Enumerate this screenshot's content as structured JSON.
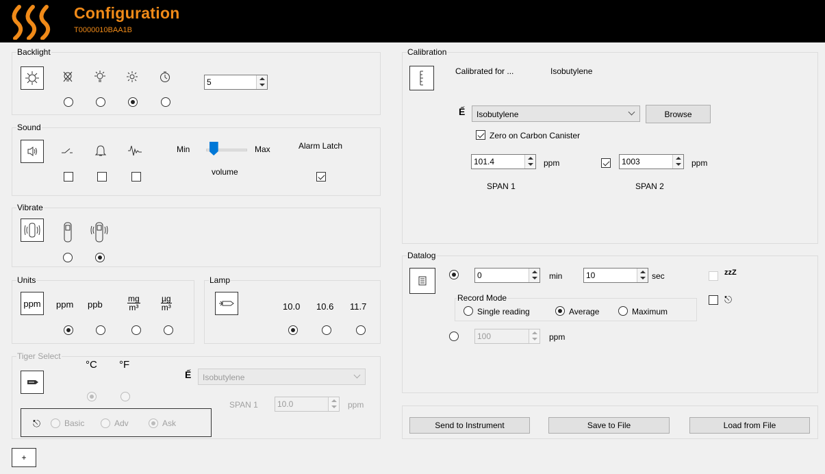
{
  "header": {
    "title": "Configuration",
    "serial": "T0000010BAA1B",
    "accent": "#f08a18",
    "icon": "heat-waves-logo"
  },
  "backlight": {
    "label": "Backlight",
    "options": [
      {
        "icon": "backlight-off-icon",
        "selected": false
      },
      {
        "icon": "backlight-on-icon",
        "selected": false
      },
      {
        "icon": "backlight-auto-icon",
        "selected": true
      },
      {
        "icon": "backlight-timer-icon",
        "selected": false
      }
    ],
    "timeout": "5"
  },
  "sound": {
    "label": "Sound",
    "options": [
      {
        "icon": "key-click-icon",
        "checked": false
      },
      {
        "icon": "alarm-bell-icon",
        "checked": false
      },
      {
        "icon": "waveform-icon",
        "checked": false
      }
    ],
    "min_label": "Min",
    "max_label": "Max",
    "volume_label": "volume",
    "volume_level": 0.1,
    "alarm_latch_label": "Alarm Latch",
    "alarm_latch": true
  },
  "vibrate": {
    "label": "Vibrate",
    "options": [
      {
        "icon": "vibrate-off-icon",
        "selected": false
      },
      {
        "icon": "vibrate-on-icon",
        "selected": true
      }
    ]
  },
  "units": {
    "label": "Units",
    "button": "ppm",
    "options": [
      {
        "text": "ppm",
        "selected": true
      },
      {
        "text": "ppb",
        "selected": false
      },
      {
        "num": "mg",
        "den": "m³",
        "selected": false
      },
      {
        "num": "µg",
        "den": "m³",
        "selected": false
      }
    ]
  },
  "lamp": {
    "label": "Lamp",
    "options": [
      {
        "text": "10.0",
        "selected": true
      },
      {
        "text": "10.6",
        "selected": false
      },
      {
        "text": "11.7",
        "selected": false
      }
    ]
  },
  "tiger": {
    "label": "Tiger Select",
    "celsius": "°C",
    "fahrenheit": "°F",
    "gas": "Isobutylene",
    "span1_label": "SPAN 1",
    "span1_value": "10.0",
    "span1_unit": "ppm",
    "modes": [
      {
        "text": "Basic",
        "selected": false
      },
      {
        "text": "Adv",
        "selected": false
      },
      {
        "text": "Ask",
        "selected": true
      }
    ]
  },
  "calibration": {
    "label": "Calibration",
    "calibrated_for_label": "Calibrated for ...",
    "calibrated_gas": "Isobutylene",
    "gas": "Isobutylene",
    "browse": "Browse",
    "zero_label": "Zero on Carbon Canister",
    "zero_checked": true,
    "span1_value": "101.4",
    "span1_unit": "ppm",
    "span1_label": "SPAN 1",
    "span2_value": "1003",
    "span2_unit": "ppm",
    "span2_label": "SPAN 2",
    "span2_checked": true
  },
  "datalog": {
    "label": "Datalog",
    "min_value": "0",
    "min_unit": "min",
    "sec_value": "10",
    "sec_unit": "sec",
    "record_mode_label": "Record Mode",
    "modes": [
      {
        "text": "Single reading",
        "selected": false
      },
      {
        "text": "Average",
        "selected": true
      },
      {
        "text": "Maximum",
        "selected": false
      }
    ],
    "threshold_value": "100",
    "threshold_unit": "ppm",
    "sleep_text": "zzZ"
  },
  "actions": {
    "send": "Send to Instrument",
    "save": "Save to File",
    "load": "Load from File"
  },
  "add_button": "+"
}
